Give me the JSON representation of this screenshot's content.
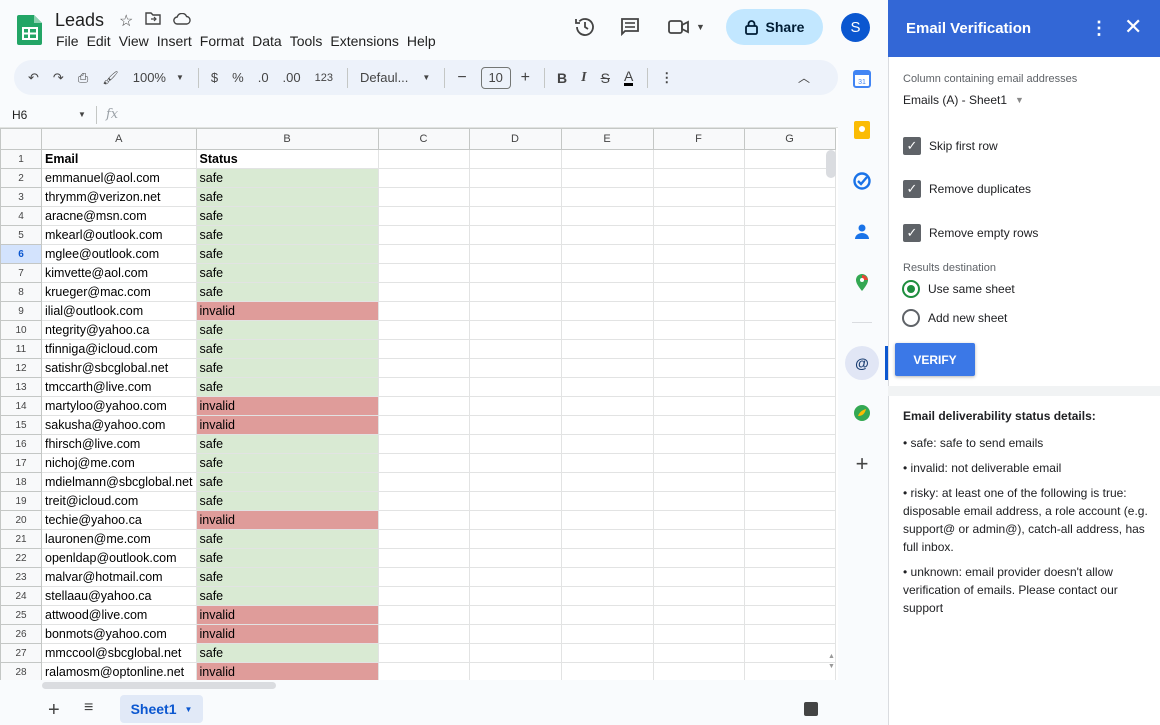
{
  "app": {
    "title": "Leads",
    "avatar_letter": "S",
    "share_label": "Share"
  },
  "menu": [
    "File",
    "Edit",
    "View",
    "Insert",
    "Format",
    "Data",
    "Tools",
    "Extensions",
    "Help"
  ],
  "toolbar": {
    "zoom": "100%",
    "currency": "$",
    "percent": "%",
    "dec_less": ".0",
    "dec_more": ".00",
    "number_fmt": "123",
    "font": "Defaul...",
    "font_size": "10",
    "bold": "B",
    "italic": "I",
    "underline_a": "A"
  },
  "formula": {
    "namebox": "H6",
    "fx": "fx"
  },
  "columns": [
    "A",
    "B",
    "C",
    "D",
    "E",
    "F",
    "G"
  ],
  "rows": [
    {
      "n": "1",
      "a": "Email",
      "b": "Status",
      "s": "hdr"
    },
    {
      "n": "2",
      "a": "emmanuel@aol.com",
      "b": "safe",
      "s": "safe"
    },
    {
      "n": "3",
      "a": "thrymm@verizon.net",
      "b": "safe",
      "s": "safe"
    },
    {
      "n": "4",
      "a": "aracne@msn.com",
      "b": "safe",
      "s": "safe"
    },
    {
      "n": "5",
      "a": "mkearl@outlook.com",
      "b": "safe",
      "s": "safe"
    },
    {
      "n": "6",
      "a": "mglee@outlook.com",
      "b": "safe",
      "s": "safe"
    },
    {
      "n": "7",
      "a": "kimvette@aol.com",
      "b": "safe",
      "s": "safe"
    },
    {
      "n": "8",
      "a": "krueger@mac.com",
      "b": "safe",
      "s": "safe"
    },
    {
      "n": "9",
      "a": "ilial@outlook.com",
      "b": "invalid",
      "s": "invalid"
    },
    {
      "n": "10",
      "a": "ntegrity@yahoo.ca",
      "b": "safe",
      "s": "safe"
    },
    {
      "n": "11",
      "a": "tfinniga@icloud.com",
      "b": "safe",
      "s": "safe"
    },
    {
      "n": "12",
      "a": "satishr@sbcglobal.net",
      "b": "safe",
      "s": "safe"
    },
    {
      "n": "13",
      "a": "tmccarth@live.com",
      "b": "safe",
      "s": "safe"
    },
    {
      "n": "14",
      "a": "martyloo@yahoo.com",
      "b": "invalid",
      "s": "invalid"
    },
    {
      "n": "15",
      "a": "sakusha@yahoo.com",
      "b": "invalid",
      "s": "invalid"
    },
    {
      "n": "16",
      "a": "fhirsch@live.com",
      "b": "safe",
      "s": "safe"
    },
    {
      "n": "17",
      "a": "nichoj@me.com",
      "b": "safe",
      "s": "safe"
    },
    {
      "n": "18",
      "a": "mdielmann@sbcglobal.net",
      "b": "safe",
      "s": "safe"
    },
    {
      "n": "19",
      "a": "treit@icloud.com",
      "b": "safe",
      "s": "safe"
    },
    {
      "n": "20",
      "a": "techie@yahoo.ca",
      "b": "invalid",
      "s": "invalid"
    },
    {
      "n": "21",
      "a": "lauronen@me.com",
      "b": "safe",
      "s": "safe"
    },
    {
      "n": "22",
      "a": "openldap@outlook.com",
      "b": "safe",
      "s": "safe"
    },
    {
      "n": "23",
      "a": "malvar@hotmail.com",
      "b": "safe",
      "s": "safe"
    },
    {
      "n": "24",
      "a": "stellaau@yahoo.ca",
      "b": "safe",
      "s": "safe"
    },
    {
      "n": "25",
      "a": "attwood@live.com",
      "b": "invalid",
      "s": "invalid"
    },
    {
      "n": "26",
      "a": "bonmots@yahoo.com",
      "b": "invalid",
      "s": "invalid"
    },
    {
      "n": "27",
      "a": "mmccool@sbcglobal.net",
      "b": "safe",
      "s": "safe"
    },
    {
      "n": "28",
      "a": "ralamosm@optonline.net",
      "b": "invalid",
      "s": "invalid"
    }
  ],
  "sheet_tab": "Sheet1",
  "panel": {
    "title": "Email Verification",
    "column_label": "Column containing email addresses",
    "column_value": "Emails (A) - Sheet1",
    "skip_first_row": "Skip first row",
    "remove_duplicates": "Remove duplicates",
    "remove_empty": "Remove empty rows",
    "results_label": "Results destination",
    "use_same": "Use same sheet",
    "add_new": "Add new sheet",
    "verify": "VERIFY",
    "details_title": "Email deliverability status details:",
    "d_safe": "• safe: safe to send emails",
    "d_invalid": "• invalid: not deliverable email",
    "d_risky": "• risky: at least one of the following is true: disposable email address, a role account (e.g. support@ or admin@), catch-all address, has full inbox.",
    "d_unknown": "• unknown: email provider doesn't allow verification of emails. Please contact our support"
  },
  "colors": {
    "safe": "#d9ead3",
    "invalid": "#df9c9a",
    "panel_header": "#3367d6",
    "verify": "#3b78e7",
    "share": "#c2e7ff"
  }
}
